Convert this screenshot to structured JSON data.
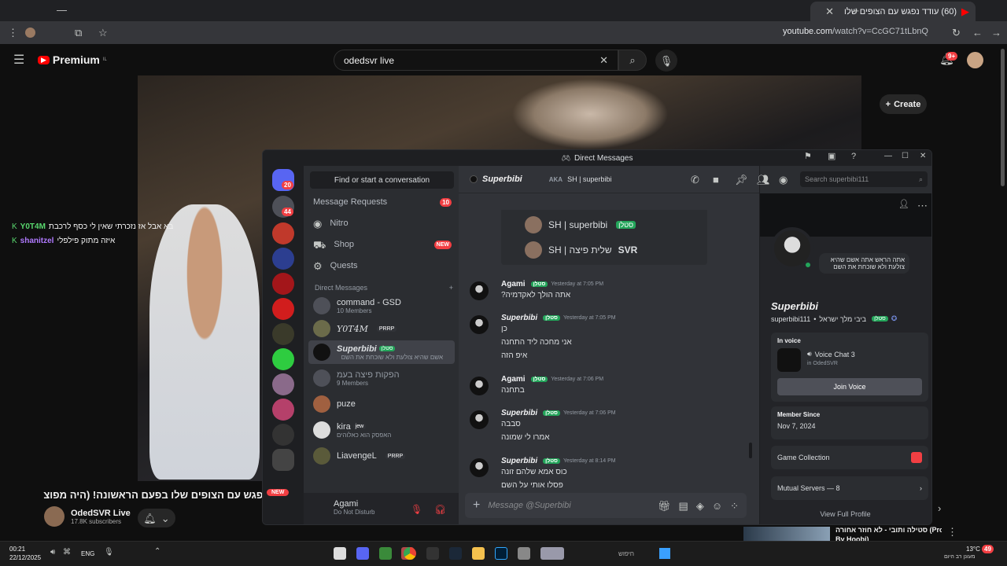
{
  "browser": {
    "tab_title": "(60) עודד נפגש עם הצופים שלו",
    "url_host": "youtube.com",
    "url_path": "/watch?v=CcGC71tLbnQ"
  },
  "youtube": {
    "logo": "Premium",
    "logo_sup": "IL",
    "search_value": "odedsvr live",
    "create_label": "Create",
    "notif_count": "9+",
    "video_title": "נפגש עם הצופים שלו בפעם הראשונה! (היה מפוצץ)",
    "channel": "OdedSVR Live",
    "subscribers": "17.8K subscribers",
    "chat": [
      {
        "name": "Y0T4M",
        "text": "בא אבל אז נזכרתי שאין לי כסף לרכבת",
        "color": "#59d86e"
      },
      {
        "name": "shanitzel",
        "text": "איזה מתוק פילפלי",
        "color": "#b07aff"
      }
    ]
  },
  "discord": {
    "window_title": "Direct Messages",
    "find_placeholder": "Find or start a conversation",
    "rail_badges": {
      "home": "20",
      "second": "44"
    },
    "new_label": "NEW",
    "nav": [
      {
        "label": "Message Requests",
        "badge": "10"
      },
      {
        "label": "Nitro",
        "badge": ""
      },
      {
        "label": "Shop",
        "badge": "NEW"
      },
      {
        "label": "Quests",
        "badge": ""
      }
    ],
    "dm_header": "Direct Messages",
    "dms": [
      {
        "name": "command - GSD",
        "sub": "10 Members",
        "tag": ""
      },
      {
        "name": "Y0T4M",
        "sub": "",
        "tag": "PRRP"
      },
      {
        "name": "Superbibi",
        "sub": "אשם שהיא צולעת ולא שוכחת את השם",
        "tag": "סטלן"
      },
      {
        "name": "הפקות פיצה בעמ",
        "sub": "9 Members",
        "tag": ""
      },
      {
        "name": "puze",
        "sub": "",
        "tag": ""
      },
      {
        "name": "kira",
        "sub": "האפסק הוא כאלוהים",
        "tag": "jew"
      },
      {
        "name": "LiavengeL",
        "sub": "",
        "tag": "PRRP"
      }
    ],
    "user": {
      "name": "Agami",
      "status": "Do Not Disturb"
    },
    "chat_header": {
      "name": "Superbibi",
      "aka": "AKA",
      "aka_value": "SH | superbibi",
      "search_placeholder": "Search superbibi111"
    },
    "embed": [
      {
        "name": "SH | superbibi",
        "tag": "סטלן"
      },
      {
        "name": "SH | שלית פיצה",
        "tag": "SVR"
      }
    ],
    "messages": [
      {
        "author": "Agami",
        "tag": "סטלן",
        "time": "Yesterday at 7:05 PM",
        "lines": [
          "אתה הולך לאקדמיה?"
        ]
      },
      {
        "author": "Superbibi",
        "tag": "סטלן",
        "time": "Yesterday at 7:05 PM",
        "lines": [
          "כן",
          "אני מחכה ליד התחנה",
          "איפ הזה"
        ]
      },
      {
        "author": "Agami",
        "tag": "סטלן",
        "time": "Yesterday at 7:06 PM",
        "lines": [
          "בתחנה"
        ]
      },
      {
        "author": "Superbibi",
        "tag": "סטלן",
        "time": "Yesterday at 7:06 PM",
        "lines": [
          "סבבה",
          "אמרו לי שמונה"
        ]
      },
      {
        "author": "Superbibi",
        "tag": "סטלן",
        "time": "Yesterday at 8:14 PM",
        "lines": [
          "כוס אמא שלהם זונה",
          "פסלו אותי על השם"
        ]
      }
    ],
    "composer_placeholder": "Message @Superbibi",
    "profile": {
      "bubble": "אתה הראש אתה אשם שהיא צולעת ולא שוכחת את השם",
      "display_name": "Superbibi",
      "username": "superbibi111",
      "extra": "ביבי מלך ישראל",
      "tag": "סטלן",
      "in_voice": "In voice",
      "voice_channel": "Voice Chat 3",
      "voice_server": "in OdedSVR",
      "join_voice": "Join Voice",
      "member_since_label": "Member Since",
      "member_since": "Nov 7, 2024",
      "game_collection": "Game Collection",
      "mutual_servers": "Mutual Servers — 8",
      "view_full": "View Full Profile"
    }
  },
  "taskbar": {
    "time": "00:21",
    "date": "22/12/2025",
    "lang": "ENG",
    "search": "חיפוש",
    "temp": "13°C",
    "weather": "מעונן רב היום",
    "badge": "49"
  },
  "side_video": {
    "title": "סטילה ותובי - לא חוזר אחורה (Prod.",
    "title2": "By Hoobi)"
  }
}
